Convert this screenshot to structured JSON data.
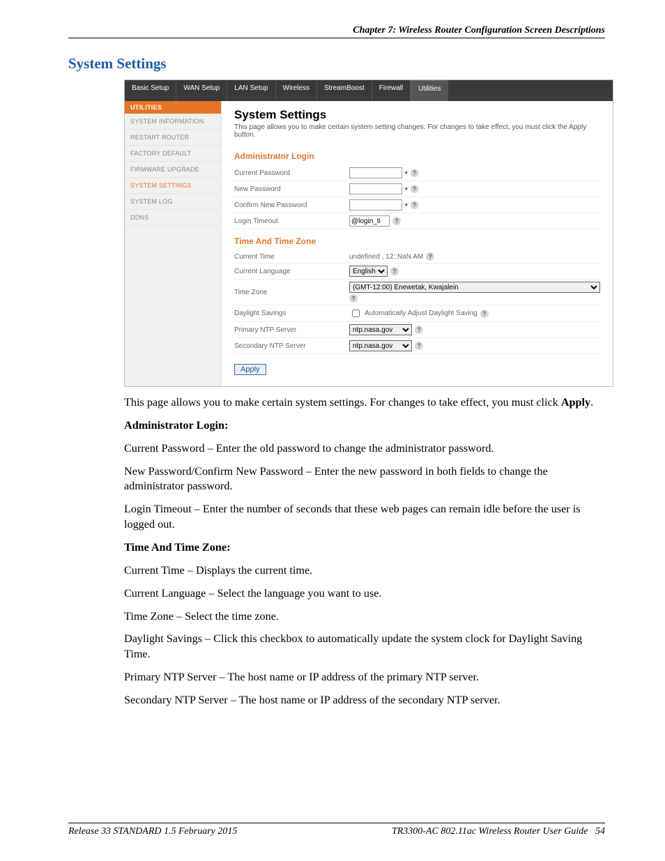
{
  "header": {
    "chapter": "Chapter 7: Wireless Router Configuration Screen Descriptions"
  },
  "section_title": "System Settings",
  "ui": {
    "nav": {
      "basic": "Basic Setup",
      "wan": "WAN Setup",
      "lan": "LAN Setup",
      "wireless": "Wireless",
      "stream": "StreamBoost",
      "firewall": "Firewall",
      "utilities": "Utilities"
    },
    "sidebar": {
      "header": "UTILITIES",
      "items": {
        "sysinfo": "SYSTEM INFORMATION",
        "restart": "RESTART ROUTER",
        "factory": "FACTORY DEFAULT",
        "firmware": "FIRMWARE UPGRADE",
        "settings": "SYSTEM SETTINGS",
        "syslog": "SYSTEM LOG",
        "ddns": "DDNS"
      }
    },
    "main": {
      "title": "System Settings",
      "desc": "This page allows you to make certain system setting changes. For changes to take effect, you must click the Apply button.",
      "admin_header": "Administrator Login",
      "rows": {
        "cur_pw": "Current Password",
        "new_pw": "New Password",
        "conf_pw": "Confirm New Password",
        "login_to": "Login Timeout",
        "login_to_val": "@login_ti"
      },
      "time_header": "Time And Time Zone",
      "time_rows": {
        "cur_time": "Current Time",
        "cur_time_val": "undefined ,   12::NaN AM",
        "cur_lang": "Current Language",
        "cur_lang_val": "English",
        "tz": "Time Zone",
        "tz_val": "(GMT-12:00) Enewetak, Kwajalein",
        "dst": "Daylight Savings",
        "dst_lbl": "Automatically Adjust Daylight Saving",
        "pri_ntp": "Primary NTP Server",
        "pri_ntp_val": "ntp.nasa.gov",
        "sec_ntp": "Secondary NTP Server",
        "sec_ntp_val": "ntp.nasa.gov"
      },
      "apply": "Apply"
    }
  },
  "body": {
    "p1a": "This page allows you to make certain system settings.  For changes to take effect, you must click ",
    "p1b": "Apply",
    "p1c": ".",
    "sh1": "Administrator Login:",
    "p2": "Current Password – Enter the old password to change the administrator password.",
    "p3": "New Password/Confirm New Password –  Enter the new password in both fields to change the administrator password.",
    "p4": "Login Timeout – Enter the number of seconds that these web pages can remain idle before the user is logged out.",
    "sh2": "Time And Time Zone:",
    "p5": "Current Time – Displays the current time.",
    "p6": "Current Language –  Select the language you want to use.",
    "p7": "Time Zone – Select the time zone.",
    "p8": "Daylight Savings – Click this checkbox to automatically update the system clock for Daylight Saving Time.",
    "p9": "Primary NTP Server – The host name or IP address of the primary NTP server.",
    "p10": "Secondary NTP Server – The host name or IP address of the secondary NTP server."
  },
  "footer": {
    "left": "Release 33 STANDARD 1.5    February 2015",
    "right_title": "TR3300-AC 802.11ac Wireless Router User Guide",
    "right_page": "54"
  }
}
